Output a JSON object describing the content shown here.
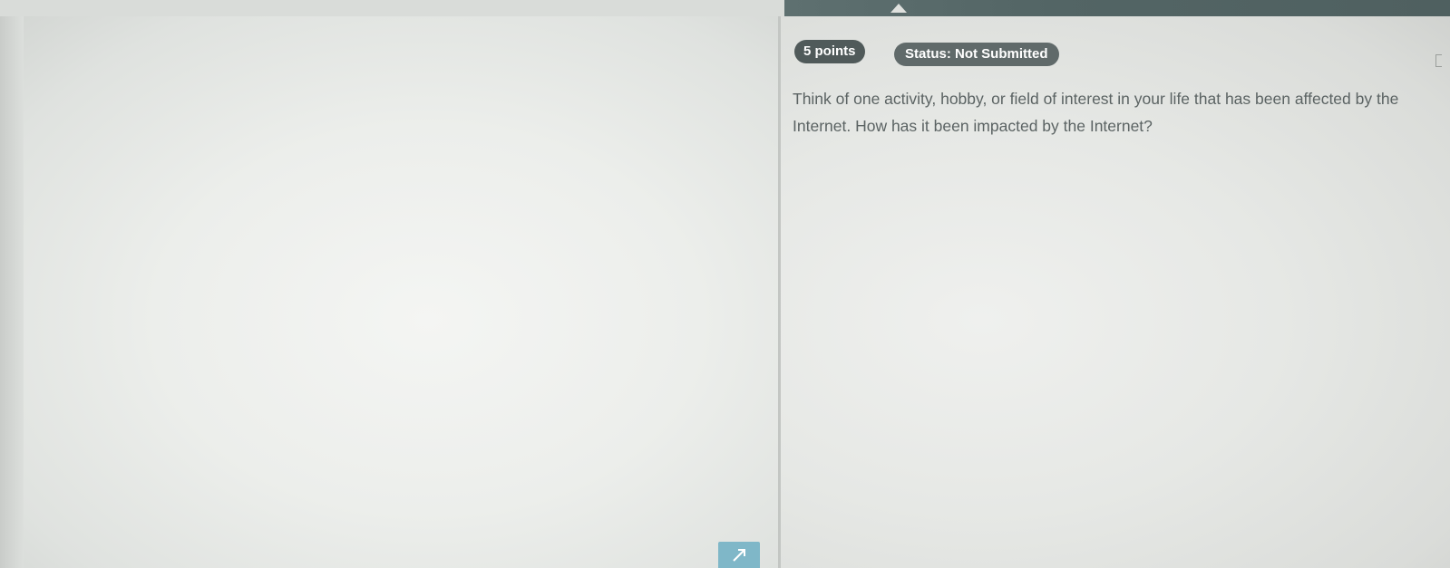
{
  "assignment": {
    "points_label": "5 points",
    "status_label": "Status: Not Submitted",
    "question_text": "Think of one activity, hobby, or field of interest in your life that has been affected by the Internet. How has it been impacted by the Internet?"
  },
  "icons": {
    "resize": "resize-arrow-icon",
    "bracket": "bracket-icon"
  },
  "colors": {
    "pill_background": "#505a5a",
    "question_text": "#5b6363",
    "header_bar": "#536565",
    "resize_handle": "#7fb7c8"
  }
}
